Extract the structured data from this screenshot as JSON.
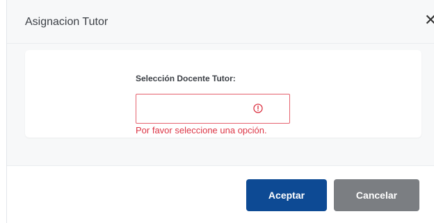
{
  "modal": {
    "title": "Asignacion Tutor",
    "close_label": "✕"
  },
  "form": {
    "field_label": "Selección Docente Tutor:",
    "selected_value": "",
    "error_message": "Por favor seleccione una opción."
  },
  "footer": {
    "accept_label": "Aceptar",
    "cancel_label": "Cancelar"
  },
  "colors": {
    "primary": "#0d4a94",
    "secondary": "#7b7e82",
    "error": "#dc3545"
  },
  "icons": {
    "close": "close-icon",
    "field_status": "alert-circle-icon"
  }
}
